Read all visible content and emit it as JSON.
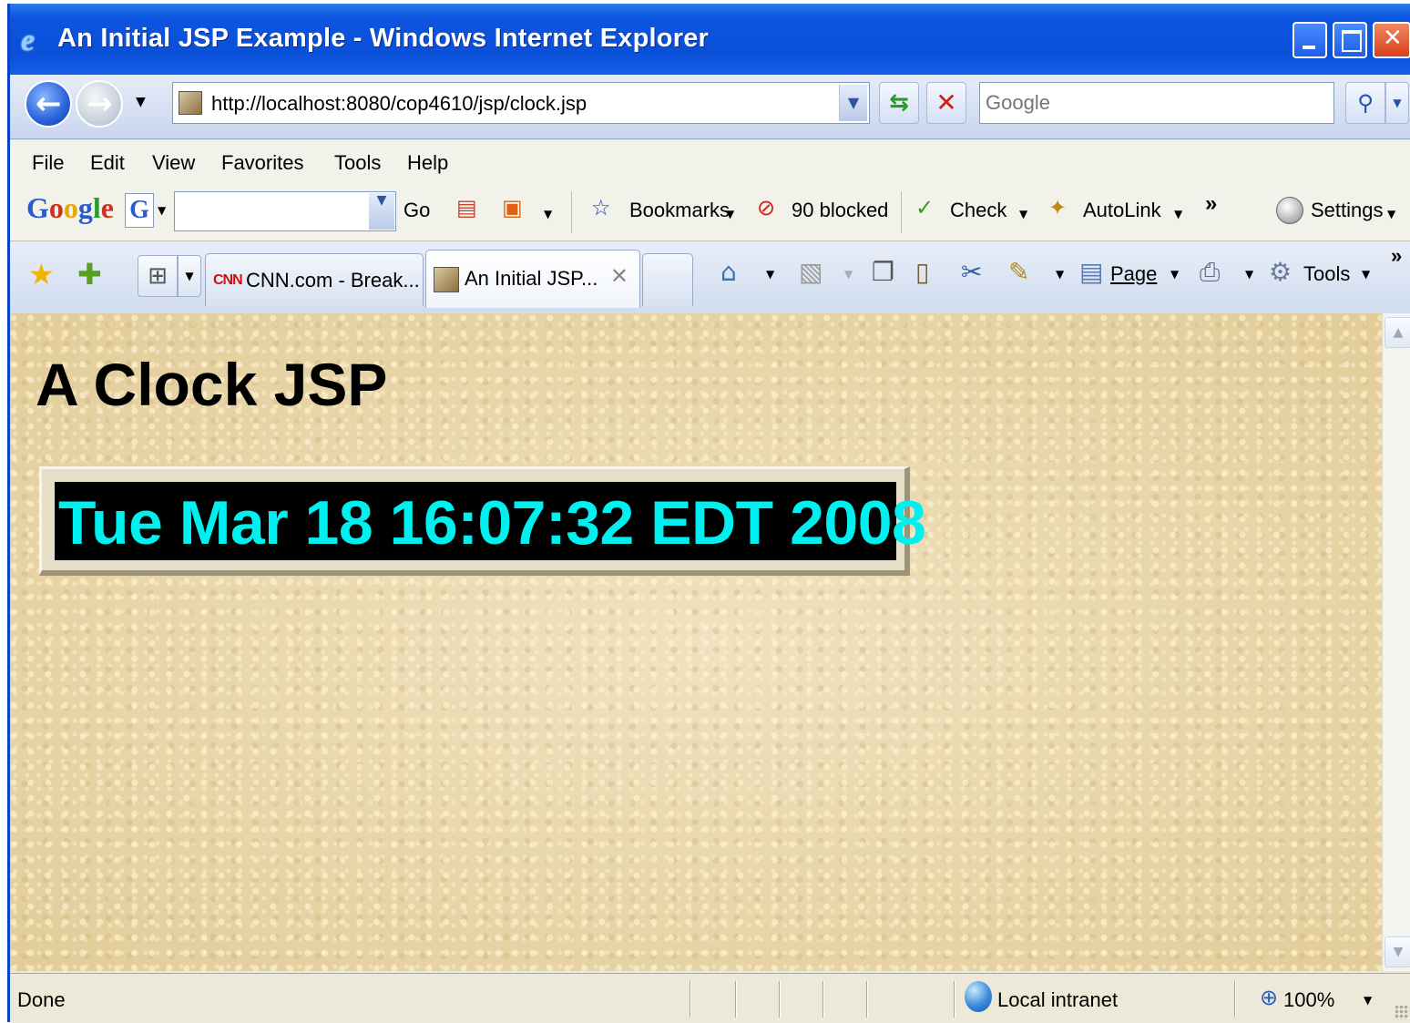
{
  "window": {
    "title": "An Initial JSP Example - Windows Internet Explorer",
    "controls": {
      "minimize": "minimize",
      "maximize": "maximize",
      "close": "✕"
    }
  },
  "nav": {
    "address": "http://localhost:8080/cop4610/jsp/clock.jsp",
    "search_placeholder": "Google"
  },
  "menu": [
    "File",
    "Edit",
    "View",
    "Favorites",
    "Tools",
    "Help"
  ],
  "google_toolbar": {
    "logo": {
      "g1": "G",
      "o1": "o",
      "o2": "o",
      "g2": "g",
      "l": "l",
      "e": "e"
    },
    "go_label": "Go",
    "bookmarks_label": "Bookmarks",
    "blocked_label": "90 blocked",
    "check_label": "Check",
    "autolink_label": "AutoLink",
    "overflow": "»",
    "settings_label": "Settings"
  },
  "tabs": [
    {
      "logo": "CNN",
      "label": "CNN.com - Break..."
    },
    {
      "label": "An Initial JSP...",
      "active": true
    }
  ],
  "command_bar": {
    "page_label": "Page",
    "tools_label": "Tools",
    "overflow": "»"
  },
  "page": {
    "heading": "A Clock JSP",
    "clock": "Tue Mar 18 16:07:32 EDT 2008"
  },
  "status": {
    "text": "Done",
    "zone": "Local intranet",
    "zoom": "100%"
  },
  "colors": {
    "titlebar": "#0a4fd8",
    "clock_text": "#00f0f0",
    "clock_bg": "#000000",
    "page_bg": "#ead9b0"
  },
  "icons": [
    "ie-logo-icon",
    "back-icon",
    "forward-icon",
    "refresh-icon",
    "stop-icon",
    "search-icon",
    "favorites-star-icon",
    "add-favorite-icon",
    "quick-tabs-icon",
    "home-icon",
    "feeds-icon",
    "print-icon",
    "tools-gear-icon",
    "local-intranet-icon",
    "zoom-icon"
  ]
}
